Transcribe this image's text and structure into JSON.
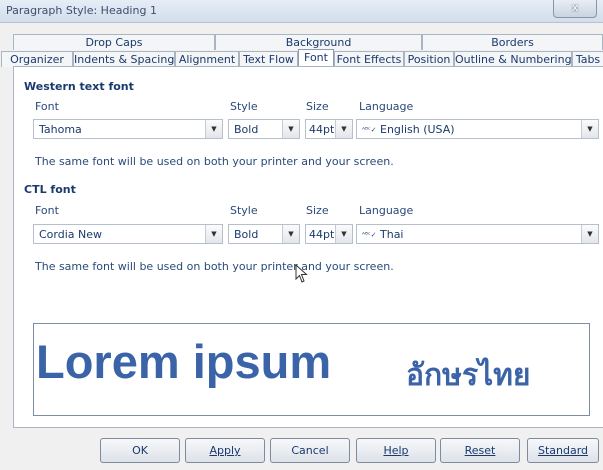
{
  "window": {
    "title": "Paragraph Style: Heading 1",
    "close_label": "x"
  },
  "tabs_row1": [
    "Drop Caps",
    "Background",
    "Borders"
  ],
  "tabs_row2": [
    "Organizer",
    "Indents & Spacing",
    "Alignment",
    "Text Flow",
    "Font",
    "Font Effects",
    "Position",
    "Outline & Numbering",
    "Tabs"
  ],
  "active_tab": "Font",
  "western": {
    "heading": "Western text font",
    "font_label": "Font",
    "style_label": "Style",
    "size_label": "Size",
    "language_label": "Language",
    "font": "Tahoma",
    "style": "Bold",
    "size": "44pt",
    "language": "English (USA)",
    "note": "The same font will be used on both your printer and your screen."
  },
  "ctl": {
    "heading": "CTL font",
    "font_label": "Font",
    "style_label": "Style",
    "size_label": "Size",
    "language_label": "Language",
    "font": "Cordia New",
    "style": "Bold",
    "size": "44pt",
    "language": "Thai",
    "note": "The same font will be used on both your printer and your screen."
  },
  "preview": {
    "western_text": "Lorem ipsum",
    "ctl_text": "อักษรไทย"
  },
  "buttons": {
    "ok": "OK",
    "apply": "Apply",
    "cancel": "Cancel",
    "help": "Help",
    "reset": "Reset",
    "standard": "Standard"
  },
  "icons": {
    "spellcheck": "spellcheck-icon",
    "dropdown": "chevron-down-icon",
    "cursor": "mouse-pointer-icon"
  },
  "colors": {
    "preview_text": "#3a63a8",
    "label_text": "#1a3a6e"
  }
}
